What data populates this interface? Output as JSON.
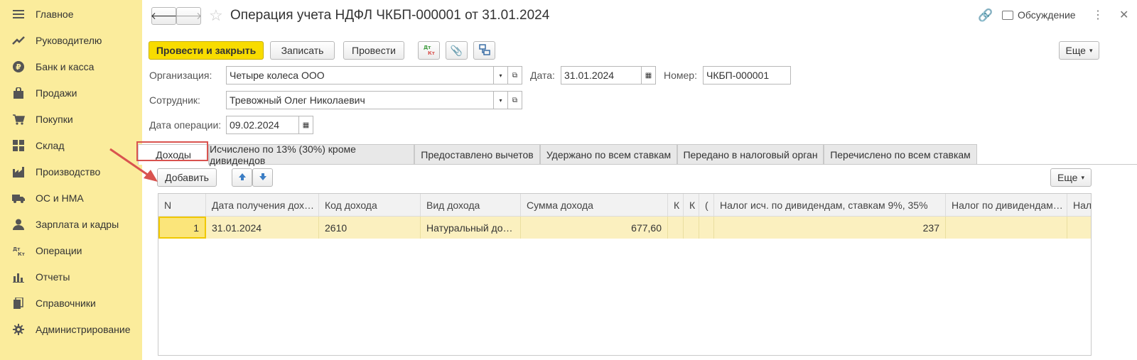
{
  "sidebar": {
    "items": [
      {
        "label": "Главное",
        "icon": "menu-icon"
      },
      {
        "label": "Руководителю",
        "icon": "trend-icon"
      },
      {
        "label": "Банк и касса",
        "icon": "ruble-icon"
      },
      {
        "label": "Продажи",
        "icon": "bag-icon"
      },
      {
        "label": "Покупки",
        "icon": "cart-icon"
      },
      {
        "label": "Склад",
        "icon": "warehouse-icon"
      },
      {
        "label": "Производство",
        "icon": "factory-icon"
      },
      {
        "label": "ОС и НМА",
        "icon": "truck-icon"
      },
      {
        "label": "Зарплата и кадры",
        "icon": "person-icon"
      },
      {
        "label": "Операции",
        "icon": "dt-kt-icon"
      },
      {
        "label": "Отчеты",
        "icon": "bar-chart-icon"
      },
      {
        "label": "Справочники",
        "icon": "books-icon"
      },
      {
        "label": "Администрирование",
        "icon": "gear-icon"
      }
    ]
  },
  "header": {
    "title": "Операция учета НДФЛ ЧКБП-000001 от 31.01.2024",
    "discussion": "Обсуждение"
  },
  "toolbar": {
    "post_close": "Провести и закрыть",
    "save": "Записать",
    "post": "Провести",
    "more": "Еще",
    "dt_kt": "Дт Кт"
  },
  "form": {
    "org_label": "Организация:",
    "org_value": "Четыре колеса ООО",
    "date_label": "Дата:",
    "date_value": "31.01.2024",
    "number_label": "Номер:",
    "number_value": "ЧКБП-000001",
    "employee_label": "Сотрудник:",
    "employee_value": "Тревожный Олег Николаевич",
    "op_date_label": "Дата операции:",
    "op_date_value": "09.02.2024"
  },
  "tabs": [
    {
      "label": "Доходы"
    },
    {
      "label": "Исчислено по 13% (30%) кроме дивидендов"
    },
    {
      "label": "Предоставлено вычетов"
    },
    {
      "label": "Удержано по всем ставкам"
    },
    {
      "label": "Передано в налоговый орган"
    },
    {
      "label": "Перечислено по всем ставкам"
    }
  ],
  "table_toolbar": {
    "add": "Добавить",
    "more": "Еще"
  },
  "table": {
    "columns": [
      "N",
      "Дата получения дох…",
      "Код дохода",
      "Вид дохода",
      "Сумма дохода",
      "К",
      "К",
      "(",
      "Налог исч. по дивидендам, ставкам 9%, 35%",
      "Налог по дивидендам…",
      "Нал"
    ],
    "rows": [
      [
        "1",
        "31.01.2024",
        "2610",
        "Натуральный до…",
        "677,60",
        "",
        "",
        "",
        "237",
        "",
        ""
      ]
    ]
  },
  "colors": {
    "sidebar_bg": "#fbec9c",
    "primary_button": "#f8dc00",
    "annotation": "#d9534f",
    "selected_row": "#fbf0bf"
  }
}
